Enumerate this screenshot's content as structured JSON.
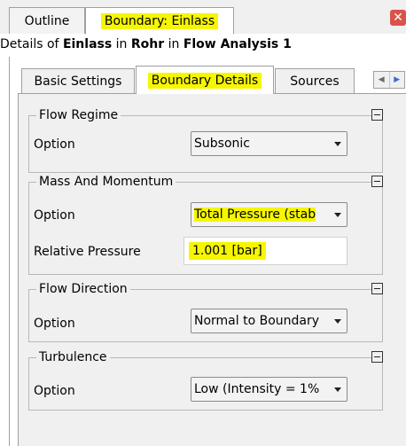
{
  "tabs": {
    "outline": "Outline",
    "boundary": "Boundary: Einlass"
  },
  "close_icon": "close-icon",
  "details": {
    "prefix": "Details of ",
    "object": "Einlass",
    "in1": " in ",
    "parent": "Rohr",
    "in2": " in ",
    "analysis": "Flow Analysis 1"
  },
  "inner_tabs": {
    "basic": "Basic Settings",
    "details": "Boundary Details",
    "sources": "Sources"
  },
  "groups": {
    "flow_regime": {
      "title": "Flow Regime",
      "option_label": "Option",
      "option_value": "Subsonic"
    },
    "mass_momentum": {
      "title": "Mass And Momentum",
      "option_label": "Option",
      "option_value": "Total Pressure (stab",
      "pressure_label": "Relative Pressure",
      "pressure_value": "1.001 [bar]"
    },
    "flow_direction": {
      "title": "Flow Direction",
      "option_label": "Option",
      "option_value": "Normal to Boundary"
    },
    "turbulence": {
      "title": "Turbulence",
      "option_label": "Option",
      "option_value": "Low (Intensity = 1%"
    }
  },
  "colors": {
    "highlight": "#f6f600",
    "panel": "#f0f0f0"
  }
}
